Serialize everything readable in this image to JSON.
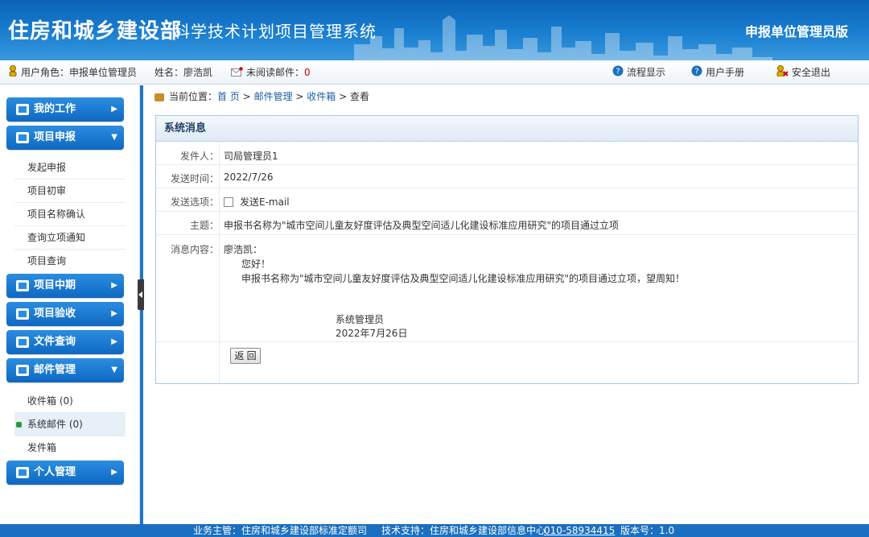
{
  "header": {
    "brand": "住房和城乡建设部",
    "system_name": "科学技术计划项目管理系统",
    "edition": "申报单位管理员版"
  },
  "infobar": {
    "role_label": "用户角色：申报单位管理员",
    "name_label": "姓名：廖浩凯",
    "unread_label": "未阅读邮件：",
    "unread_count": "0",
    "flow_link": "流程显示",
    "manual_link": "用户手册",
    "logout_link": "安全退出"
  },
  "sidebar": {
    "sections": [
      {
        "label": "我的工作",
        "arrow": "▶"
      },
      {
        "label": "项目申报",
        "arrow": "▼"
      },
      {
        "label": "项目中期",
        "arrow": "▶"
      },
      {
        "label": "项目验收",
        "arrow": "▶"
      },
      {
        "label": "文件查询",
        "arrow": "▶"
      },
      {
        "label": "邮件管理",
        "arrow": "▼"
      },
      {
        "label": "个人管理",
        "arrow": "▶"
      }
    ],
    "project_items": [
      "发起申报",
      "项目初审",
      "项目名称确认",
      "查询立项通知",
      "项目查询"
    ],
    "mail_items": [
      "收件箱 (0)",
      "系统邮件 (0)",
      "发件箱"
    ]
  },
  "breadcrumb": {
    "prefix": "当前位置：",
    "home": "首 页",
    "sep": ">",
    "mail": "邮件管理",
    "inbox": "收件箱",
    "view": "查看"
  },
  "message": {
    "panel_title": "系统消息",
    "sender_label": "发件人：",
    "sender": "司局管理员1",
    "time_label": "发送时间：",
    "time": "2022/7/26",
    "options_label": "发送选项：",
    "email_option": "发送E-mail",
    "subject_label": "主题：",
    "subject": "申报书名称为\"城市空间儿童友好度评估及典型空间适儿化建设标准应用研究\"的项目通过立项",
    "content_label": "消息内容：",
    "content_greeting": "廖浩凯：",
    "content_hello": "您好！",
    "content_body": "申报书名称为\"城市空间儿童友好度评估及典型空间适儿化建设标准应用研究\"的项目通过立项，望周知！",
    "content_signer": "系统管理员",
    "content_date": "2022年7月26日",
    "back_button": "返 回"
  },
  "footer": {
    "owner": "业务主管：住房和城乡建设部标准定额司",
    "support": "技术支持：住房和城乡建设部信息中心",
    "phone": "010-58934415",
    "version": "版本号：1.0"
  },
  "colors": {
    "header_blue": "#0a63b8",
    "nav_blue": "#0f68c2",
    "unread_red": "#d40000",
    "active_dot": "#2a9a3b"
  }
}
